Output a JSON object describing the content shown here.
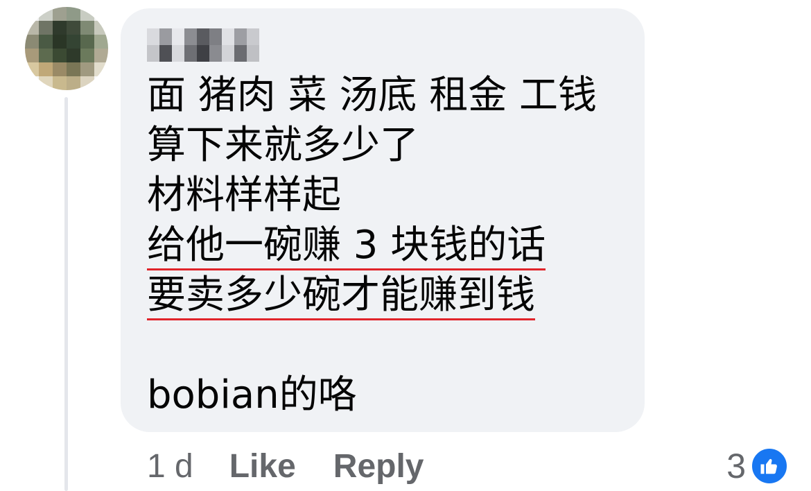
{
  "comment": {
    "lines": [
      "面 猪肉 菜 汤底 租金 工钱",
      "算下来就多少了",
      "材料样样起",
      "给他一碗赚 3 块钱的话",
      "要卖多少碗才能赚到钱",
      "bobian的咯"
    ],
    "underline_color": "#e0242a"
  },
  "actions": {
    "timestamp": "1 d",
    "like_label": "Like",
    "reply_label": "Reply"
  },
  "reactions": {
    "count": "3",
    "icon": "thumbs-up-icon",
    "badge_color": "#1877f2"
  },
  "colors": {
    "bubble": "#f0f2f5",
    "text": "#050505",
    "secondary_text": "#65676b"
  }
}
